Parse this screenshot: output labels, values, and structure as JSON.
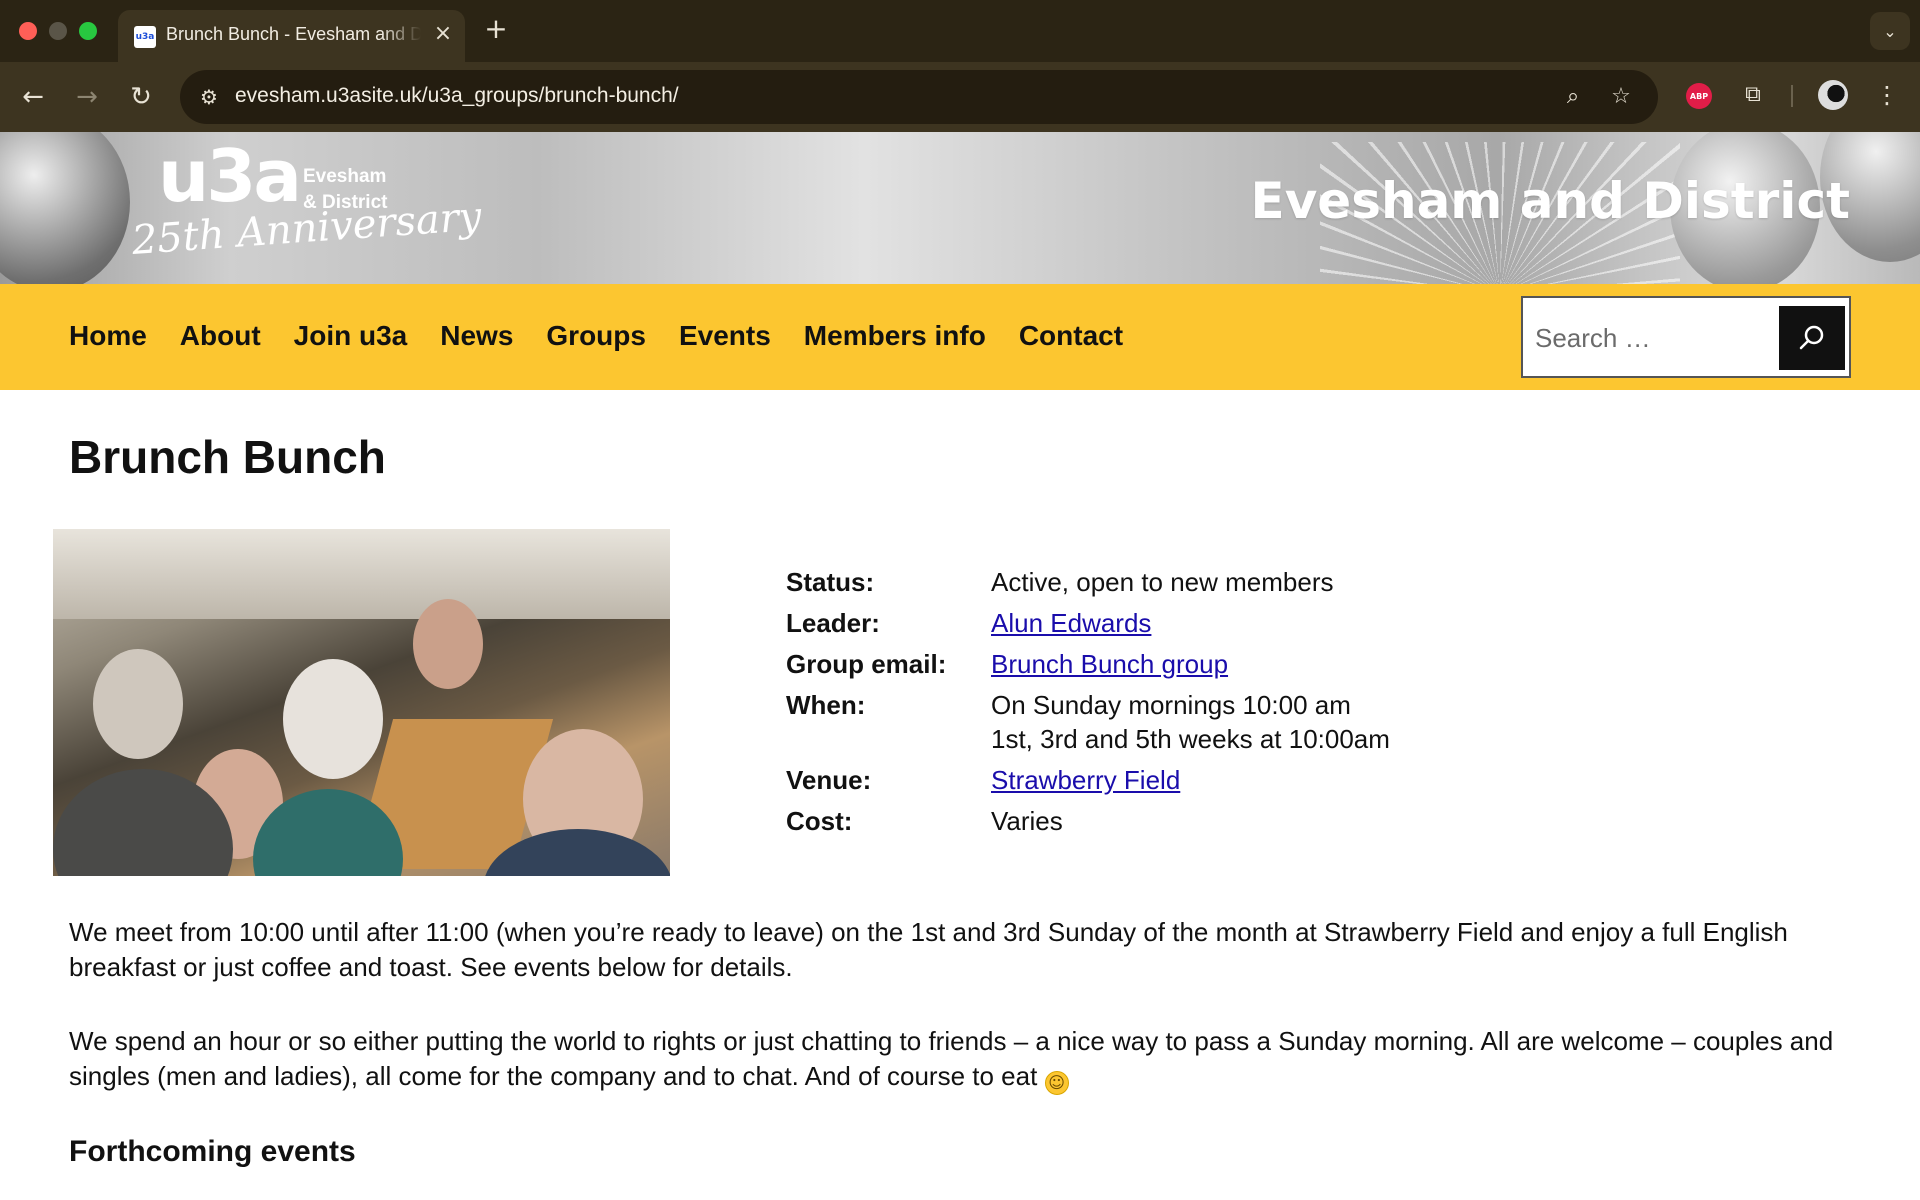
{
  "browser": {
    "tab_title": "Brunch Bunch - Evesham and District",
    "tab_favicon_text": "u3a",
    "url": "evesham.u3asite.uk/u3a_groups/brunch-bunch/",
    "extension_abp": "ABP",
    "icons": [
      "back-arrow-icon",
      "forward-arrow-icon",
      "reload-icon",
      "site-settings-icon",
      "zoom-icon",
      "bookmark-star-icon",
      "puzzle-icon",
      "profile-icon",
      "kebab-menu-icon",
      "close-icon",
      "plus-icon",
      "chevron-down-icon"
    ]
  },
  "header": {
    "logo_main": "u3a",
    "logo_location_line1": "Evesham",
    "logo_location_line2": "& District",
    "logo_tagline": "25th Anniversary",
    "site_title": "Evesham and District"
  },
  "nav": {
    "items": [
      "Home",
      "About",
      "Join u3a",
      "News",
      "Groups",
      "Events",
      "Members info",
      "Contact"
    ],
    "search_placeholder": "Search …"
  },
  "main": {
    "title": "Brunch Bunch",
    "details": {
      "status_label": "Status:",
      "status_value": "Active, open to new members",
      "leader_label": "Leader:",
      "leader_value": "Alun Edwards",
      "email_label": "Group email:",
      "email_value": "Brunch Bunch group",
      "when_label": "When:",
      "when_value_line1": "On Sunday mornings 10:00 am",
      "when_value_line2": "1st, 3rd and 5th weeks at 10:00am",
      "venue_label": "Venue:",
      "venue_value": "Strawberry Field",
      "cost_label": "Cost:",
      "cost_value": "Varies"
    },
    "paragraph1": "We meet from 10:00 until after 11:00 (when you’re ready to leave) on the 1st and 3rd Sunday of the month at Strawberry Field and enjoy a full English breakfast or just coffee and toast. See events below for details.",
    "paragraph2": "We spend an hour or so either putting the world to rights or just chatting to friends – a nice way to pass a Sunday morning. All are welcome – couples and singles (men and ladies), all come for the company and to chat. And of course to eat",
    "section_heading": "Forthcoming events"
  },
  "colors": {
    "nav_background": "#fcc630",
    "link": "#1a0dab",
    "chrome_dark": "#2b2414",
    "chrome_toolbar": "#3d3420"
  }
}
